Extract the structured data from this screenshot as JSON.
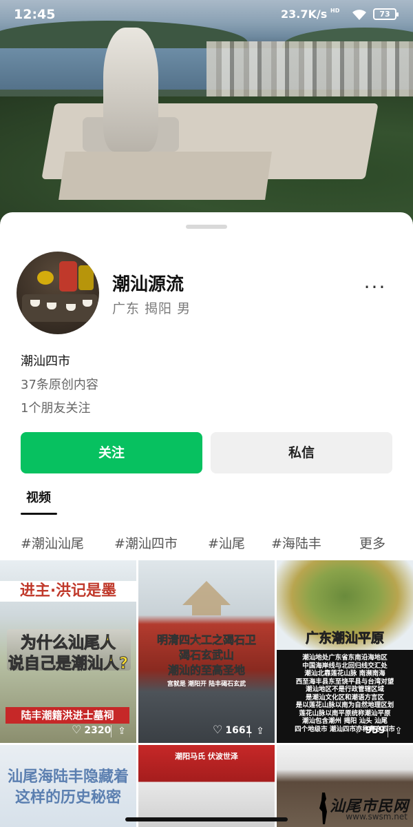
{
  "status_bar": {
    "time": "12:45",
    "network_speed": "23.7K/s",
    "network_tag": "HD",
    "battery": "73"
  },
  "profile": {
    "name": "潮汕源流",
    "meta": "广东 揭阳 男",
    "more_label": "···",
    "bio_title": "潮汕四市",
    "original_count": "37条原创内容",
    "friends_following": "1个朋友关注"
  },
  "actions": {
    "follow_label": "关注",
    "message_label": "私信"
  },
  "tabs": {
    "active": "视频"
  },
  "tags": [
    "#潮汕汕尾",
    "#潮汕四市",
    "#汕尾",
    "#海陆丰",
    "更多"
  ],
  "videos": [
    {
      "top_text": "进主·洪记是墨",
      "title_line1": "为什么汕尾人",
      "title_line2": "说自己是潮汕人?",
      "caption": "陆丰潮籍洪进士墓祠",
      "likes": "2320"
    },
    {
      "title_line1": "明清四大工之碣石卫",
      "title_line2": "碣石玄武山",
      "title_line3": "潮汕的至高圣地",
      "small_caption": "宫就是 潮阳开 陆丰碣石玄武",
      "likes": "1661"
    },
    {
      "title": "广东潮汕平原",
      "body": [
        "潮汕地处广东省东南沿海地区",
        "中国海岸线与北回归线交汇处",
        "潮汕北靠莲花山脉 南濒南海",
        "西至海丰县东至饶平县与台湾对望",
        "潮汕地区不是行政管辖区域",
        "是潮汕文化区和潮语方言区",
        "是以莲花山脉以南为自然地理区划",
        "莲花山脉以南平原统称潮汕平原",
        "潮汕包含潮州 揭阳 汕头 汕尾",
        "四个地级市 潮汕四市亦称粤东四市"
      ],
      "likes": "959"
    },
    {
      "title_line1": "汕尾海陆丰隐藏着",
      "title_line2": "这样的历史秘密"
    },
    {
      "caption": "潮阳马氏 伏波世泽"
    },
    {}
  ],
  "watermark": {
    "text": "汕尾市民网",
    "url": "www.swsm.net"
  },
  "colors": {
    "accent_green": "#07c160",
    "secondary_button": "#f0f0f0",
    "caption_yellow": "#ffe033",
    "banner_red": "#c62828"
  }
}
